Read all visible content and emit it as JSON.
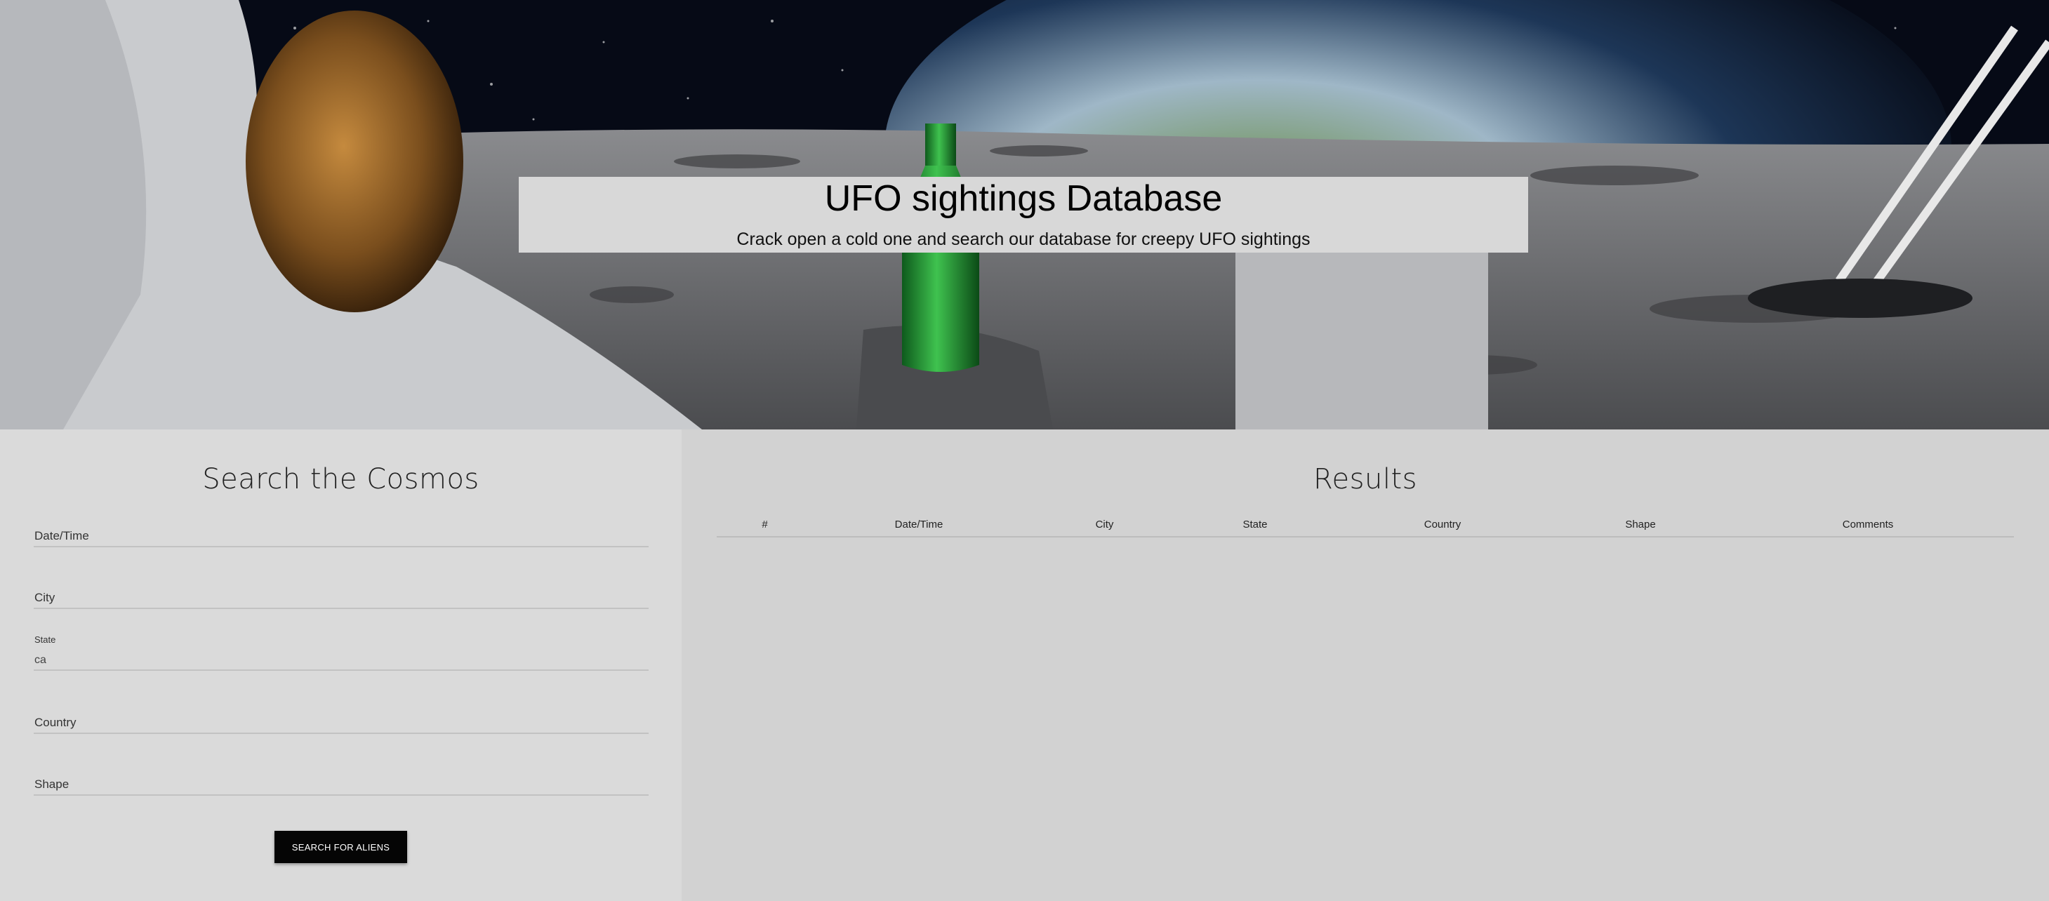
{
  "hero": {
    "title": "UFO sightings Database",
    "subtitle": "Crack open a cold one and search our database for creepy UFO sightings"
  },
  "search_panel": {
    "title": "Search the Cosmos",
    "fields": [
      {
        "label": "Date/Time",
        "value": ""
      },
      {
        "label": "City",
        "value": ""
      },
      {
        "label": "State",
        "value": "ca"
      },
      {
        "label": "Country",
        "value": ""
      },
      {
        "label": "Shape",
        "value": ""
      }
    ],
    "button_label": "SEARCH FOR ALIENS"
  },
  "results_panel": {
    "title": "Results",
    "columns": [
      "#",
      "Date/Time",
      "City",
      "State",
      "Country",
      "Shape",
      "Comments"
    ],
    "rows": []
  },
  "colors": {
    "button_bg": "#050505",
    "left_panel_bg": "#dadada",
    "right_panel_bg": "#d2d2d2",
    "bottle_green": "#2f9a3a"
  }
}
